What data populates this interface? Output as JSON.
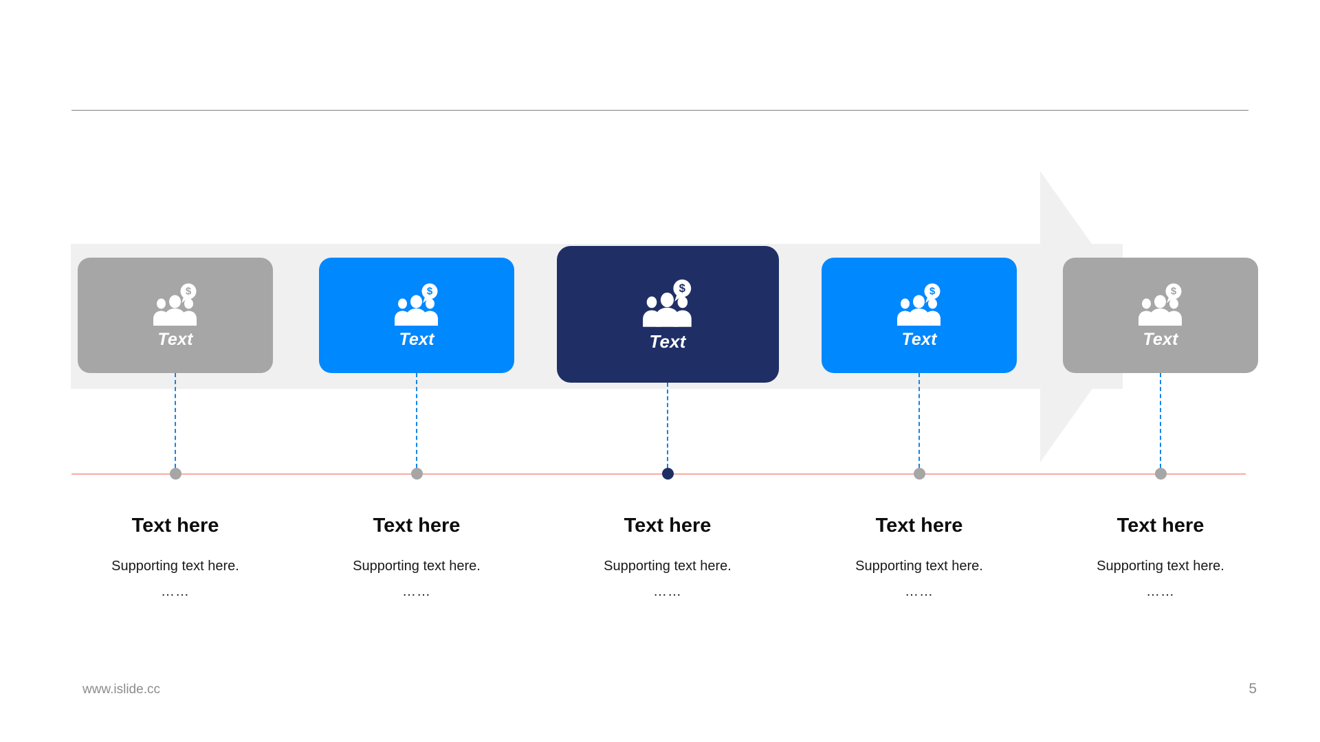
{
  "slide": {
    "page_number": "5",
    "footer_url": "www.islide.cc",
    "colors": {
      "band": "#f0f0f0",
      "card_inactive": "#a6a6a6",
      "card_blue": "#0088ff",
      "card_navy": "#1f2f66",
      "connector": "#1184e8",
      "timeline_line": "#f6aca3",
      "dot_inactive": "#a6a6a6",
      "dot_active": "#1f2f66",
      "divider": "#7d7d7d",
      "title_text": "#0d0d0d",
      "body_text": "#191919",
      "footer_text": "#8c8c8c"
    }
  },
  "steps": [
    {
      "id": "step-1",
      "card_label": "Text",
      "card_color": "#a6a6a6",
      "state": "inactive",
      "icon": "people-money-icon",
      "dot_color": "#a6a6a6",
      "title": "Text here",
      "body": "Supporting text here.",
      "more": "……"
    },
    {
      "id": "step-2",
      "card_label": "Text",
      "card_color": "#0088ff",
      "state": "inactive",
      "icon": "people-money-icon",
      "dot_color": "#a6a6a6",
      "title": "Text here",
      "body": "Supporting text here.",
      "more": "……"
    },
    {
      "id": "step-3",
      "card_label": "Text",
      "card_color": "#1f2f66",
      "state": "active",
      "icon": "people-money-icon",
      "dot_color": "#1f2f66",
      "title": "Text here",
      "body": "Supporting text here.",
      "more": "……"
    },
    {
      "id": "step-4",
      "card_label": "Text",
      "card_color": "#0088ff",
      "state": "inactive",
      "icon": "people-money-icon",
      "dot_color": "#a6a6a6",
      "title": "Text here",
      "body": "Supporting text here.",
      "more": "……"
    },
    {
      "id": "step-5",
      "card_label": "Text",
      "card_color": "#a6a6a6",
      "state": "inactive",
      "icon": "people-money-icon",
      "dot_color": "#a6a6a6",
      "title": "Text here",
      "body": "Supporting text here.",
      "more": "……"
    }
  ]
}
